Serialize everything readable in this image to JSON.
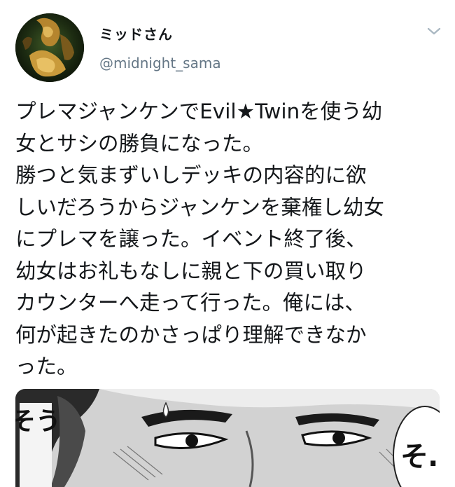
{
  "tweet": {
    "author": {
      "display_name": "ミッドさん",
      "handle": "@midnight_sama",
      "avatar_icon": "avatar-image"
    },
    "menu_icon": "chevron-down-icon",
    "text_lines": [
      "プレマジャンケンでEvil★Twinを使う幼",
      "女とサシの勝負になった。",
      "勝つと気まずいしデッキの内容的に欲",
      "しいだろうからジャンケンを棄権し幼女",
      "にプレマを譲った。イベント終了後、",
      "幼女はお礼もなしに親と下の買い取り",
      "カウンターへ走って行った。俺には、",
      "何が起きたのかさっぱり理解できなか",
      "った。"
    ],
    "media": {
      "type": "manga-panel-image",
      "visible_text_left": "そう",
      "visible_text_right": "そ…"
    }
  },
  "colors": {
    "text": "#14171a",
    "secondary": "#657786",
    "chevron": "#aab8c2"
  }
}
